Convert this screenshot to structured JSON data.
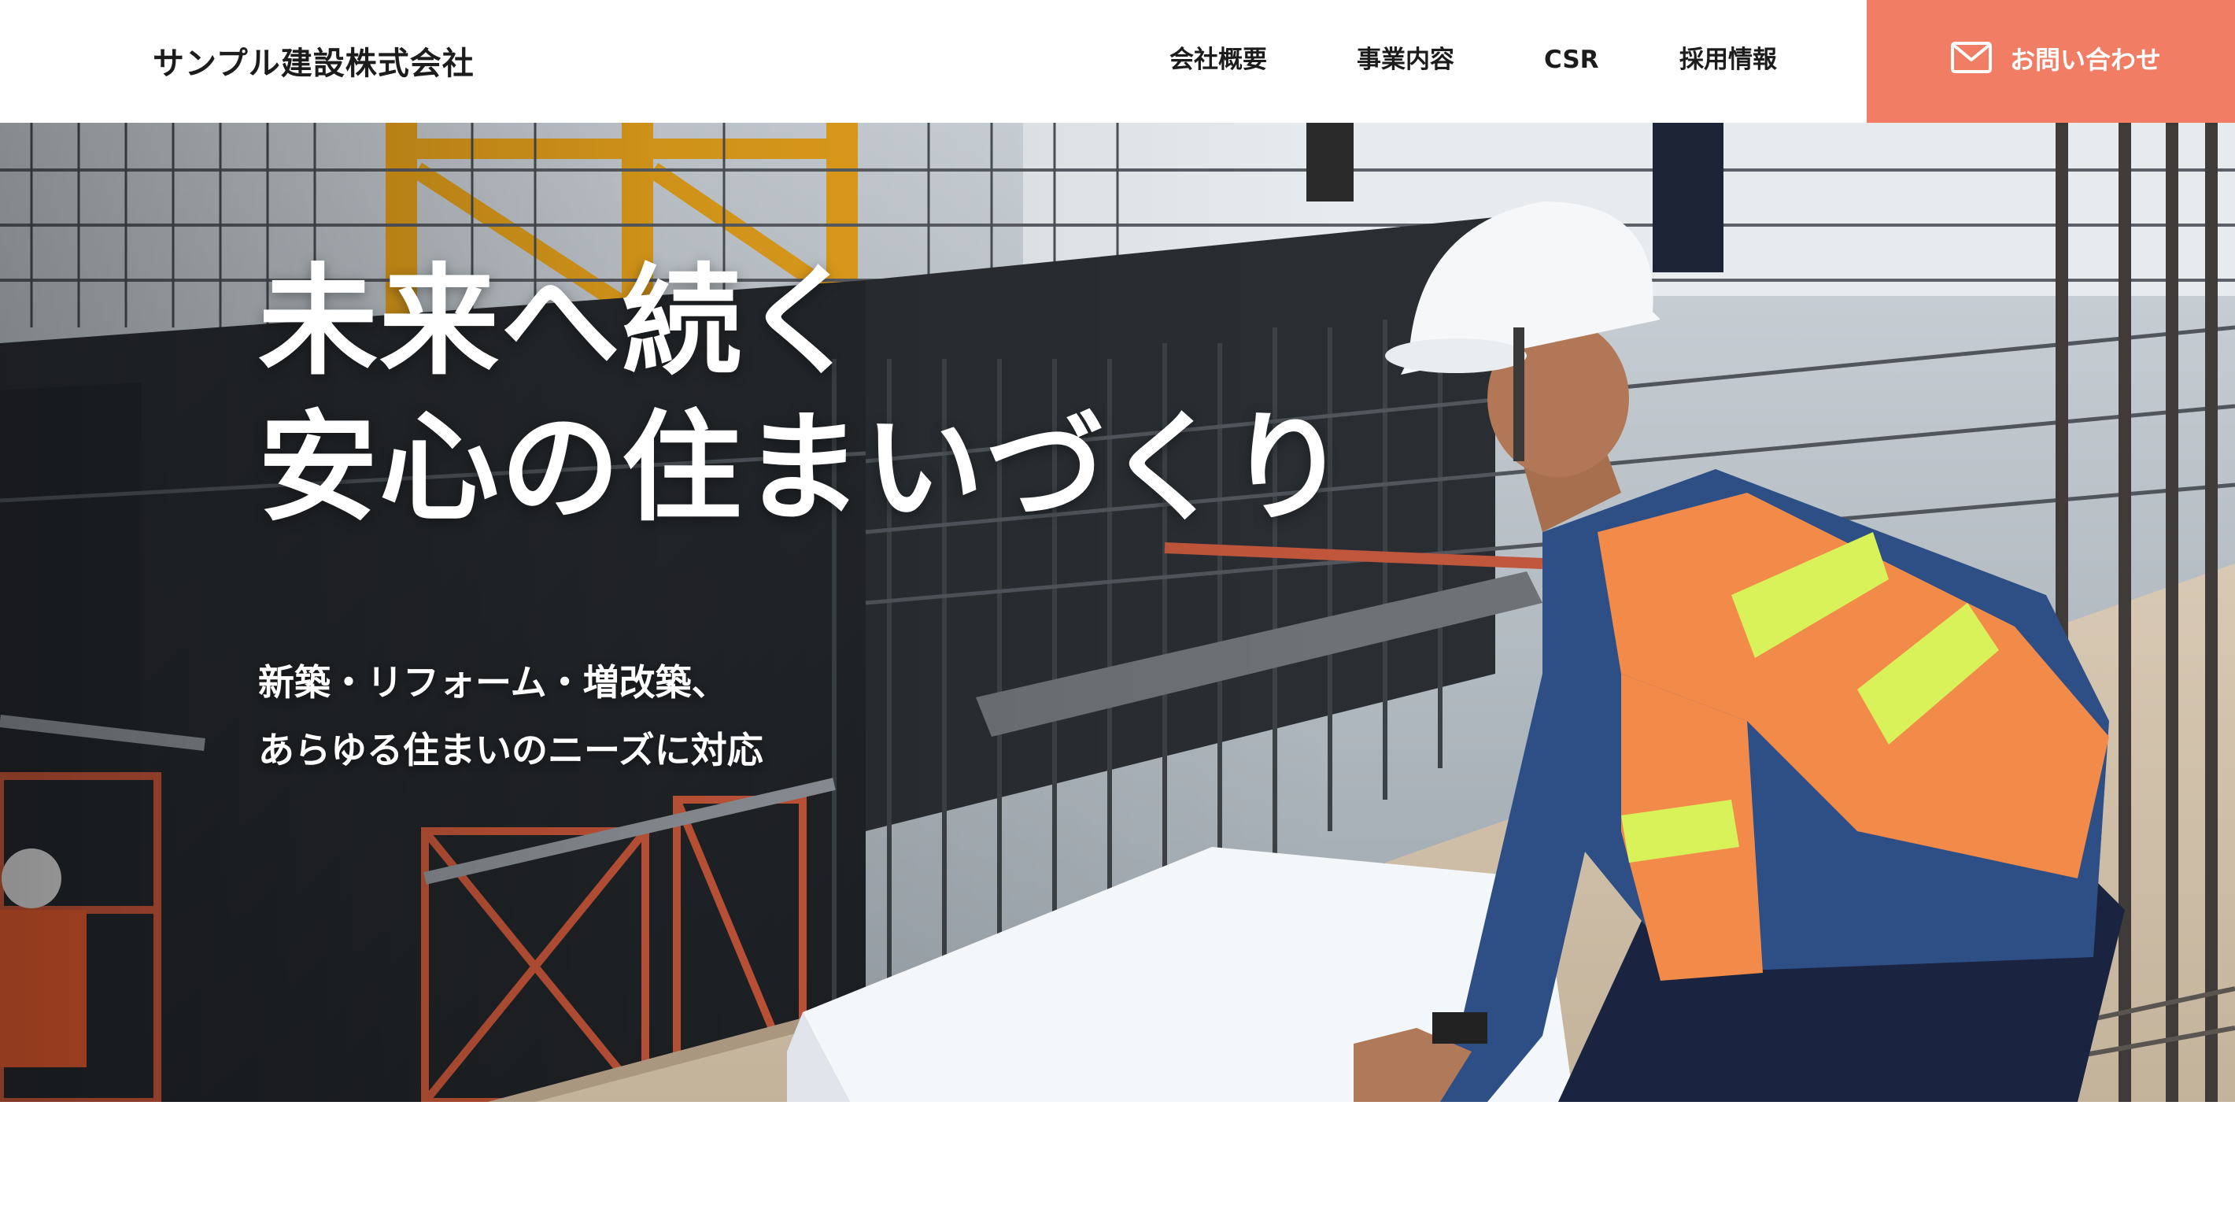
{
  "header": {
    "company_name": "サンプル建設株式会社",
    "nav": [
      {
        "label": "会社概要"
      },
      {
        "label": "事業内容"
      },
      {
        "label": "CSR"
      },
      {
        "label": "採用情報"
      }
    ],
    "contact": {
      "label": "お問い合わせ",
      "icon": "mail-icon"
    }
  },
  "hero": {
    "title_lines": [
      "未来へ続く",
      "安心の住まいづくり"
    ],
    "subtitle_lines": [
      "新築・リフォーム・増改築、",
      "あらゆる住まいのニーズに対応"
    ]
  },
  "colors": {
    "accent": "#f07d64",
    "text_dark": "#1c1c1c",
    "hero_text": "#ffffff"
  }
}
